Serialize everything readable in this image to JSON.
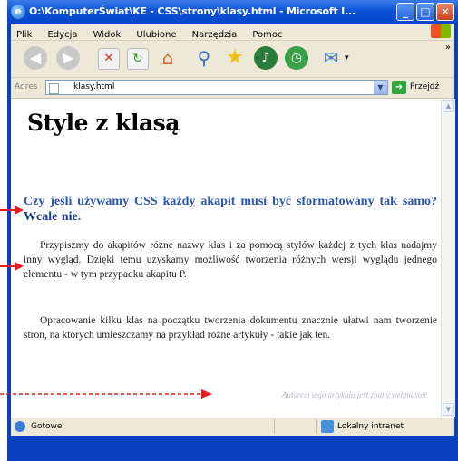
{
  "window": {
    "title": "O:\\KomputerŚwiat\\KE - CSS\\strony\\klasy.html - Microsoft I...",
    "minimize_glyph": "_",
    "maximize_glyph": "□",
    "close_glyph": "✕"
  },
  "menu": {
    "items": [
      "Plik",
      "Edycja",
      "Widok",
      "Ulubione",
      "Narzędzia",
      "Pomoc"
    ]
  },
  "address": {
    "label": "Adres",
    "value": "klasy.html",
    "go_label": "Przejdź"
  },
  "page": {
    "heading": "Style z klasą",
    "sub_part1": "Czy jeśli używamy CSS każdy akapit musi być sformatowany tak samo? ",
    "sub_part2": "Wcale nie",
    "sub_part3": ".",
    "p1": "Przypiszmy do akapitów różne nazwy klas i za pomocą stylów każdej z tych klas nadajmy inny wygląd. Dzięki temu uzyskamy możliwość tworzenia różnych wersji wyglądu jednego elementu - w tym przypadku akapitu P.",
    "p2": "Opracowanie kilku klas na początku tworzenia dokumentu znacznie ułatwi nam tworzenie stron, na których umieszczamy na przykład różne artykuły - takie jak ten.",
    "author": "Autorem tego artykułu jest znany webmaster."
  },
  "status": {
    "text": "Gotowe",
    "zone": "Lokalny intranet"
  },
  "colors": {
    "title_bar": "#0a50d6",
    "heading_blue": "#2a55b0",
    "annotation_red": "#e02020"
  }
}
